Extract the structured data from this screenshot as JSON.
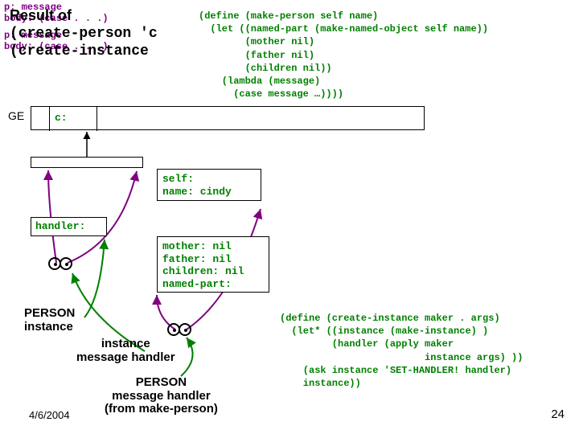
{
  "title": {
    "ln1": "Result of",
    "ln2": "(create-person 'c",
    "ln3": "(create-instance"
  },
  "top_code": "(define (make-person self name)\n  (let ((named-part (make-named-object self name))\n        (mother nil)\n        (father nil)\n        (children nil))\n    (lambda (message)\n      (case message …))))",
  "ge_label": "GE",
  "ge_cell": "c:",
  "self_box": "self:\nname: cindy",
  "handler_box": "handler:",
  "pb1": "p: message\nbody: (case . . .)",
  "mother_box": "mother: nil\nfather: nil\nchildren: nil\nnamed-part:",
  "pb2": "p: message\nbody: (case . . .)",
  "labels": {
    "person_instance": "PERSON\ninstance",
    "instance_mh": "instance\nmessage handler",
    "person_mh": "PERSON\nmessage handler\n(from make-person)"
  },
  "bottom_code": "(define (create-instance maker . args)\n  (let* ((instance (make-instance) )\n         (handler (apply maker\n                         instance args) ))\n    (ask instance 'SET-HANDLER! handler)\n    instance))",
  "footer": {
    "date": "4/6/2004",
    "page": "24"
  }
}
